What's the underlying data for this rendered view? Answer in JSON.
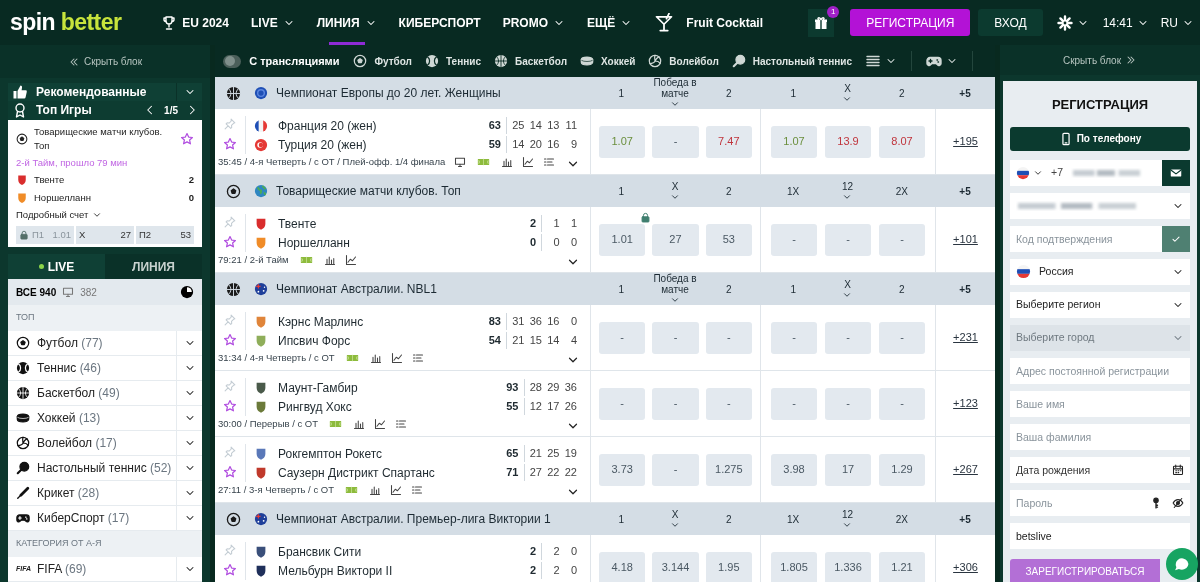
{
  "header": {
    "logo": {
      "part_1": "spin",
      "part_2": "better"
    },
    "nav": [
      {
        "label": "EU 2024",
        "kind": "trophy",
        "dropdown": false,
        "selected": false
      },
      {
        "label": "LIVE",
        "kind": "plain",
        "dropdown": true,
        "selected": false
      },
      {
        "label": "ЛИНИЯ",
        "kind": "plain",
        "dropdown": true,
        "selected": true
      },
      {
        "label": "КИБЕРСПОРТ",
        "kind": "plain",
        "dropdown": false,
        "selected": false
      },
      {
        "label": "PROMO",
        "kind": "plain",
        "dropdown": true,
        "selected": false
      },
      {
        "label": "ЕЩЁ",
        "kind": "plain",
        "dropdown": true,
        "selected": false
      },
      {
        "label": "Fruit Cocktail",
        "kind": "cocktail",
        "dropdown": false,
        "selected": false
      }
    ],
    "gift_badge": "1",
    "register_button": "РЕГИСТРАЦИЯ",
    "login_button": "ВХОД",
    "time": "14:41",
    "language": "RU"
  },
  "left_sidebar": {
    "hide_label": "Скрыть блок",
    "recommended_label": "Рекомендованные",
    "top_games": {
      "label": "Топ Игры",
      "pager": "1/5",
      "card": {
        "league": "Товарищеские матчи клубов. Топ",
        "status": "2-й Тайм, прошло 79 мин",
        "teams": [
          {
            "name": "Твенте",
            "score": "2",
            "color": "#d92d2d"
          },
          {
            "name": "Норшелланн",
            "score": "0",
            "color": "#f08c28"
          }
        ],
        "details_label": "Подробный счет",
        "odds": [
          {
            "label": "П1",
            "value": "1.01",
            "locked": true
          },
          {
            "label": "X",
            "value": "27",
            "locked": false
          },
          {
            "label": "П2",
            "value": "53",
            "locked": false
          }
        ]
      }
    },
    "tabs": [
      {
        "label": "LIVE",
        "selected": true
      },
      {
        "label": "ЛИНИЯ",
        "selected": false
      }
    ],
    "summary": {
      "all_label": "ВСЕ 940",
      "streams": "382"
    },
    "sections": [
      {
        "title": "ТОП",
        "items": [
          {
            "kind": "football",
            "name": "Футбол",
            "count": "(77)"
          },
          {
            "kind": "tennis",
            "name": "Теннис",
            "count": "(46)"
          },
          {
            "kind": "basketball",
            "name": "Баскетбол",
            "count": "(49)"
          },
          {
            "kind": "hockey",
            "name": "Хоккей",
            "count": "(13)"
          },
          {
            "kind": "volleyball",
            "name": "Волейбол",
            "count": "(17)"
          },
          {
            "kind": "table-tennis",
            "name": "Настольный теннис",
            "count": "(52)"
          },
          {
            "kind": "cricket",
            "name": "Крикет",
            "count": "(28)"
          },
          {
            "kind": "esports",
            "name": "КиберСпорт",
            "count": "(17)"
          }
        ]
      },
      {
        "title": "КАТЕГОРИЯ ОТ А-Я",
        "items": [
          {
            "kind": "fifa",
            "logo": "FIFA",
            "name": "FIFA",
            "count": "(69)"
          }
        ]
      }
    ]
  },
  "filter_bar": {
    "toggle": {
      "label": "С трансляциями",
      "on": false
    },
    "sports": [
      {
        "kind": "football",
        "label": "Футбол"
      },
      {
        "kind": "tennis",
        "label": "Теннис"
      },
      {
        "kind": "basketball",
        "label": "Баскетбол"
      },
      {
        "kind": "hockey",
        "label": "Хоккей"
      },
      {
        "kind": "volleyball",
        "label": "Волейбол"
      },
      {
        "kind": "table-tennis",
        "label": "Настольный теннис"
      }
    ],
    "menus": [
      {
        "kind": "list"
      },
      {
        "kind": "esports"
      }
    ]
  },
  "leagues": [
    {
      "sport_icon": {
        "kind": "basketball"
      },
      "flag": {
        "kind": "europe"
      },
      "name": "Чемпионат Европы до 20 лет. Женщины",
      "columns": [
        {
          "label": "1",
          "dropdown": false
        },
        {
          "label": "Победа в матче",
          "dropdown": true
        },
        {
          "label": "2",
          "dropdown": false
        },
        {
          "label": "1",
          "dropdown": false
        },
        {
          "label": "X",
          "dropdown": true
        },
        {
          "label": "2",
          "dropdown": false
        },
        {
          "label": "+5",
          "dropdown": false
        }
      ],
      "matches": [
        {
          "teams": [
            {
              "name": "Франция 20 (жен)",
              "kind": "france-flag",
              "total": "63",
              "periods": [
                "25",
                "14",
                "13",
                "11"
              ]
            },
            {
              "name": "Турция 20 (жен)",
              "kind": "turkey-flag",
              "total": "59",
              "periods": [
                "14",
                "20",
                "16",
                "9"
              ]
            }
          ],
          "info": "35:45 / 4-я Четверть / с ОТ / Плей-офф. 1/4 финала",
          "icons": [
            {
              "kind": "monitor"
            },
            {
              "kind": "field"
            },
            {
              "kind": "stats"
            },
            {
              "kind": "chart"
            },
            {
              "kind": "list"
            }
          ],
          "odds": [
            {
              "value": "1.07",
              "kind": "up",
              "locked": false
            },
            {
              "value": "-",
              "kind": "plain",
              "locked": false
            },
            {
              "value": "7.47",
              "kind": "down",
              "locked": false
            },
            {
              "value": "1.07",
              "kind": "up",
              "locked": false
            },
            {
              "value": "13.9",
              "kind": "down",
              "locked": false
            },
            {
              "value": "8.07",
              "kind": "down",
              "locked": false
            }
          ],
          "more": "+195"
        }
      ]
    },
    {
      "sport_icon": {
        "kind": "football"
      },
      "flag": {
        "kind": "globe"
      },
      "name": "Товарищеские матчи клубов. Топ",
      "columns": [
        {
          "label": "1",
          "dropdown": false
        },
        {
          "label": "X",
          "dropdown": true
        },
        {
          "label": "2",
          "dropdown": false
        },
        {
          "label": "1X",
          "dropdown": false
        },
        {
          "label": "12",
          "dropdown": true
        },
        {
          "label": "2X",
          "dropdown": false
        },
        {
          "label": "+5",
          "dropdown": false
        }
      ],
      "matches": [
        {
          "teams": [
            {
              "name": "Твенте",
              "kind": "crest",
              "color": "#d92d2d",
              "total": "2",
              "periods": [
                "1",
                "1"
              ]
            },
            {
              "name": "Норшелланн",
              "kind": "crest",
              "color": "#f08c28",
              "total": "0",
              "periods": [
                "0",
                "0"
              ]
            }
          ],
          "info": "79:21 / 2-й Тайм",
          "icons": [
            {
              "kind": "field"
            },
            {
              "kind": "stats"
            },
            {
              "kind": "chart"
            }
          ],
          "odds": [
            {
              "value": "1.01",
              "kind": "plain",
              "locked": true
            },
            {
              "value": "27",
              "kind": "plain",
              "locked": false
            },
            {
              "value": "53",
              "kind": "plain",
              "locked": false
            },
            {
              "value": "-",
              "kind": "plain",
              "locked": false
            },
            {
              "value": "-",
              "kind": "plain",
              "locked": false
            },
            {
              "value": "-",
              "kind": "plain",
              "locked": false
            }
          ],
          "more": "+101"
        }
      ]
    },
    {
      "sport_icon": {
        "kind": "basketball"
      },
      "flag": {
        "kind": "australia"
      },
      "name": "Чемпионат Австралии. NBL1",
      "columns": [
        {
          "label": "1",
          "dropdown": false
        },
        {
          "label": "Победа в матче",
          "dropdown": true
        },
        {
          "label": "2",
          "dropdown": false
        },
        {
          "label": "1",
          "dropdown": false
        },
        {
          "label": "X",
          "dropdown": true
        },
        {
          "label": "2",
          "dropdown": false
        },
        {
          "label": "+5",
          "dropdown": false
        }
      ],
      "matches": [
        {
          "teams": [
            {
              "name": "Кэрнс Марлинс",
              "kind": "crest",
              "color": "#e0853a",
              "total": "83",
              "periods": [
                "31",
                "36",
                "16",
                "0"
              ]
            },
            {
              "name": "Ипсвич Форс",
              "kind": "crest",
              "color": "#8fae5a",
              "total": "54",
              "periods": [
                "21",
                "15",
                "14",
                "4"
              ]
            }
          ],
          "info": "31:34 / 4-я Четверть / с ОТ",
          "icons": [
            {
              "kind": "field"
            },
            {
              "kind": "stats"
            },
            {
              "kind": "chart"
            },
            {
              "kind": "list"
            }
          ],
          "odds": [
            {
              "value": "-",
              "kind": "plain",
              "locked": false
            },
            {
              "value": "-",
              "kind": "plain",
              "locked": false
            },
            {
              "value": "-",
              "kind": "plain",
              "locked": false
            },
            {
              "value": "-",
              "kind": "plain",
              "locked": false
            },
            {
              "value": "-",
              "kind": "plain",
              "locked": false
            },
            {
              "value": "-",
              "kind": "plain",
              "locked": false
            }
          ],
          "more": "+231"
        },
        {
          "teams": [
            {
              "name": "Маунт-Гамбир",
              "kind": "crest",
              "color": "#4a5a4a",
              "total": "93",
              "periods": [
                "28",
                "29",
                "36"
              ]
            },
            {
              "name": "Рингвуд Хокс",
              "kind": "crest",
              "color": "#6b7a3a",
              "total": "55",
              "periods": [
                "12",
                "17",
                "26"
              ]
            }
          ],
          "info": "30:00 / Перерыв / с ОТ",
          "icons": [
            {
              "kind": "field"
            },
            {
              "kind": "stats"
            },
            {
              "kind": "chart"
            },
            {
              "kind": "list"
            }
          ],
          "odds": [
            {
              "value": "-",
              "kind": "plain",
              "locked": false
            },
            {
              "value": "-",
              "kind": "plain",
              "locked": false
            },
            {
              "value": "-",
              "kind": "plain",
              "locked": false
            },
            {
              "value": "-",
              "kind": "plain",
              "locked": false
            },
            {
              "value": "-",
              "kind": "plain",
              "locked": false
            },
            {
              "value": "-",
              "kind": "plain",
              "locked": false
            }
          ],
          "more": "+123"
        },
        {
          "teams": [
            {
              "name": "Рокгемптон Рокетс",
              "kind": "crest",
              "color": "#5a78b8",
              "total": "65",
              "periods": [
                "21",
                "25",
                "19"
              ]
            },
            {
              "name": "Саузерн Дистрикт Спартанс",
              "kind": "crest",
              "color": "#c0392b",
              "total": "71",
              "periods": [
                "27",
                "22",
                "22"
              ]
            }
          ],
          "info": "27:11 / 3-я Четверть / с ОТ",
          "icons": [
            {
              "kind": "field"
            },
            {
              "kind": "stats"
            },
            {
              "kind": "chart"
            },
            {
              "kind": "list"
            }
          ],
          "odds": [
            {
              "value": "3.73",
              "kind": "plain",
              "locked": false
            },
            {
              "value": "-",
              "kind": "plain",
              "locked": false
            },
            {
              "value": "1.275",
              "kind": "plain",
              "locked": false
            },
            {
              "value": "3.98",
              "kind": "plain",
              "locked": false
            },
            {
              "value": "17",
              "kind": "plain",
              "locked": false
            },
            {
              "value": "1.29",
              "kind": "plain",
              "locked": false
            }
          ],
          "more": "+267"
        }
      ]
    },
    {
      "sport_icon": {
        "kind": "football"
      },
      "flag": {
        "kind": "australia"
      },
      "name": "Чемпионат Австралии. Премьер-лига Виктории 1",
      "columns": [
        {
          "label": "1",
          "dropdown": false
        },
        {
          "label": "X",
          "dropdown": true
        },
        {
          "label": "2",
          "dropdown": false
        },
        {
          "label": "1X",
          "dropdown": false
        },
        {
          "label": "12",
          "dropdown": true
        },
        {
          "label": "2X",
          "dropdown": false
        },
        {
          "label": "+5",
          "dropdown": false
        }
      ],
      "matches": [
        {
          "teams": [
            {
              "name": "Брансвик Сити",
              "kind": "crest",
              "color": "#3a4f7a",
              "total": "2",
              "periods": [
                "2",
                "0"
              ]
            },
            {
              "name": "Мельбурн Виктори II",
              "kind": "crest",
              "color": "#1f2f5a",
              "total": "2",
              "periods": [
                "2",
                "0"
              ]
            }
          ],
          "odds": [
            {
              "value": "4.18",
              "kind": "plain",
              "locked": false
            },
            {
              "value": "3.144",
              "kind": "plain",
              "locked": false
            },
            {
              "value": "1.95",
              "kind": "plain",
              "locked": false
            },
            {
              "value": "1.805",
              "kind": "plain",
              "locked": false
            },
            {
              "value": "1.336",
              "kind": "plain",
              "locked": false
            },
            {
              "value": "1.21",
              "kind": "plain",
              "locked": false
            }
          ],
          "more": "+306"
        }
      ]
    }
  ],
  "registration": {
    "hide_label": "Скрыть блок",
    "title": "РЕГИСТРАЦИЯ",
    "method_button": "По телефону",
    "fields": [
      {
        "kind": "phone",
        "prefix": "+7",
        "disabled": false
      },
      {
        "kind": "blurred-select",
        "disabled": false
      },
      {
        "kind": "code",
        "placeholder": "Код подтверждения",
        "disabled": false
      },
      {
        "kind": "country",
        "value": "Россия",
        "disabled": false
      },
      {
        "kind": "select",
        "value": "Выберите регион",
        "disabled": false
      },
      {
        "kind": "select",
        "value": "Выберите город",
        "disabled": true
      },
      {
        "kind": "text",
        "placeholder": "Адрес постоянной регистрации",
        "disabled": false
      },
      {
        "kind": "text",
        "placeholder": "Ваше имя",
        "disabled": false
      },
      {
        "kind": "text",
        "placeholder": "Ваша фамилия",
        "disabled": false
      },
      {
        "kind": "date",
        "placeholder": "Дата рождения",
        "disabled": false
      },
      {
        "kind": "password",
        "placeholder": "Пароль",
        "disabled": false
      },
      {
        "kind": "text",
        "value": "betslive",
        "disabled": false
      }
    ],
    "submit_button": "ЗАРЕГИСТРИРОВАТЬСЯ"
  }
}
